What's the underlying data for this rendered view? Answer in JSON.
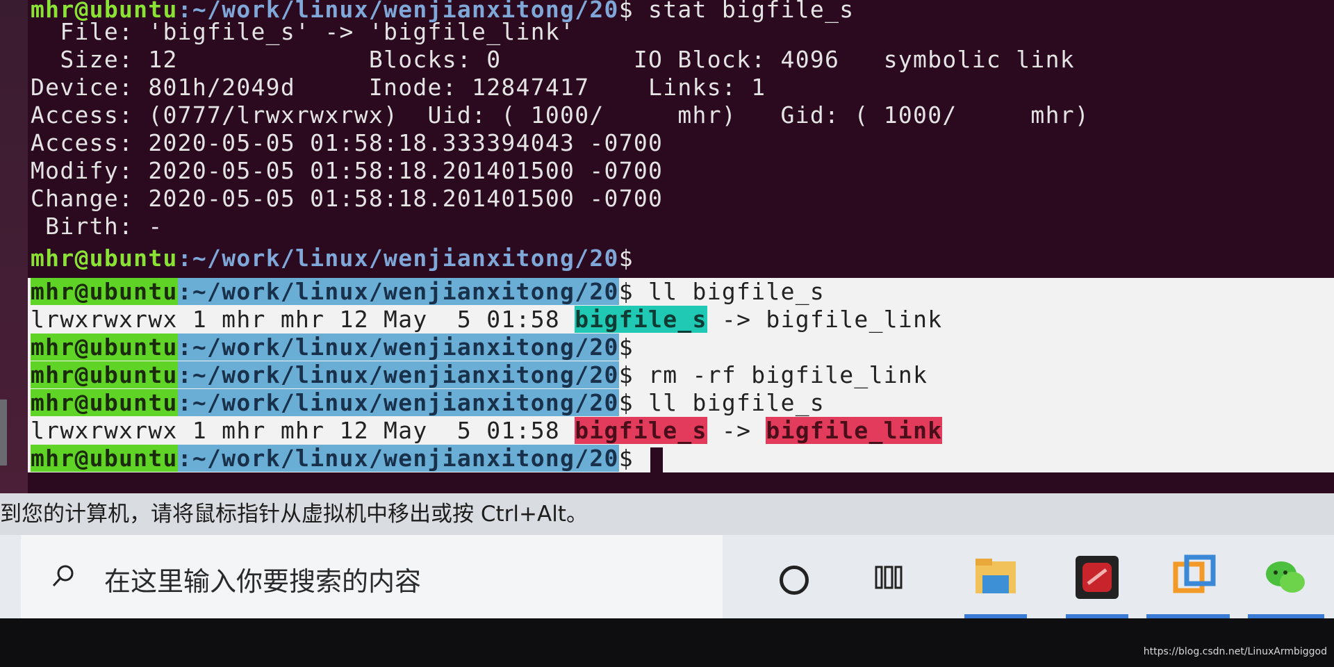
{
  "terminal": {
    "lines": [
      {
        "kind": "prompt",
        "user": "mhr@ubuntu",
        "path": ":~/work/linux/wenjianxitong/20",
        "cmd": "$ stat bigfile_s"
      },
      {
        "kind": "text",
        "text": "  File: 'bigfile_s' -> 'bigfile_link'"
      },
      {
        "kind": "text",
        "text": "  Size: 12             Blocks: 0         IO Block: 4096   symbolic link"
      },
      {
        "kind": "text",
        "text": "Device: 801h/2049d     Inode: 12847417    Links: 1"
      },
      {
        "kind": "text",
        "text": "Access: (0777/lrwxrwxrwx)  Uid: ( 1000/     mhr)   Gid: ( 1000/     mhr)"
      },
      {
        "kind": "text",
        "text": "Access: 2020-05-05 01:58:18.333394043 -0700"
      },
      {
        "kind": "text",
        "text": "Modify: 2020-05-05 01:58:18.201401500 -0700"
      },
      {
        "kind": "text",
        "text": "Change: 2020-05-05 01:58:18.201401500 -0700"
      },
      {
        "kind": "text",
        "text": " Birth: -"
      }
    ],
    "dark_prompt": {
      "user": "mhr@ubuntu",
      "path": ":~/work/linux/wenjianxitong/20",
      "cmd": "$"
    },
    "light": {
      "p1": {
        "user": "mhr@ubuntu",
        "path": ":~/work/linux/wenjianxitong/20",
        "cmd": "$ ll bigfile_s"
      },
      "o1": {
        "pre": "lrwxrwxrwx 1 mhr mhr 12 May  5 01:58 ",
        "name": "bigfile_s",
        "arrow": " -> ",
        "target": "bigfile_link"
      },
      "p2": {
        "user": "mhr@ubuntu",
        "path": ":~/work/linux/wenjianxitong/20",
        "cmd": "$"
      },
      "p3": {
        "user": "mhr@ubuntu",
        "path": ":~/work/linux/wenjianxitong/20",
        "cmd": "$ rm -rf bigfile_link"
      },
      "p4": {
        "user": "mhr@ubuntu",
        "path": ":~/work/linux/wenjianxitong/20",
        "cmd": "$ ll bigfile_s"
      },
      "o2": {
        "pre": "lrwxrwxrwx 1 mhr mhr 12 May  5 01:58 ",
        "name": "bigfile_s",
        "arrow": " -> ",
        "target": "bigfile_link"
      },
      "p5": {
        "user": "mhr@ubuntu",
        "path": ":~/work/linux/wenjianxitong/20",
        "cmd": "$"
      }
    }
  },
  "status_bar": {
    "text": "到您的计算机，请将鼠标指针从虚拟机中移出或按 Ctrl+Alt。"
  },
  "taskbar": {
    "search_placeholder": "在这里输入你要搜索的内容",
    "icons": [
      "search-icon",
      "cortana-icon",
      "task-view-icon",
      "file-explorer-icon",
      "red-app-icon",
      "vmware-icon",
      "wechat-icon"
    ]
  },
  "watermark": "https://blog.csdn.net/LinuxArmbiggod",
  "colors": {
    "terminal_bg": "#2b0a20",
    "prompt_user": "#8ae234",
    "prompt_path": "#6aaed6",
    "link_ok": "#20c9b4",
    "link_broken": "#e23b5b"
  }
}
